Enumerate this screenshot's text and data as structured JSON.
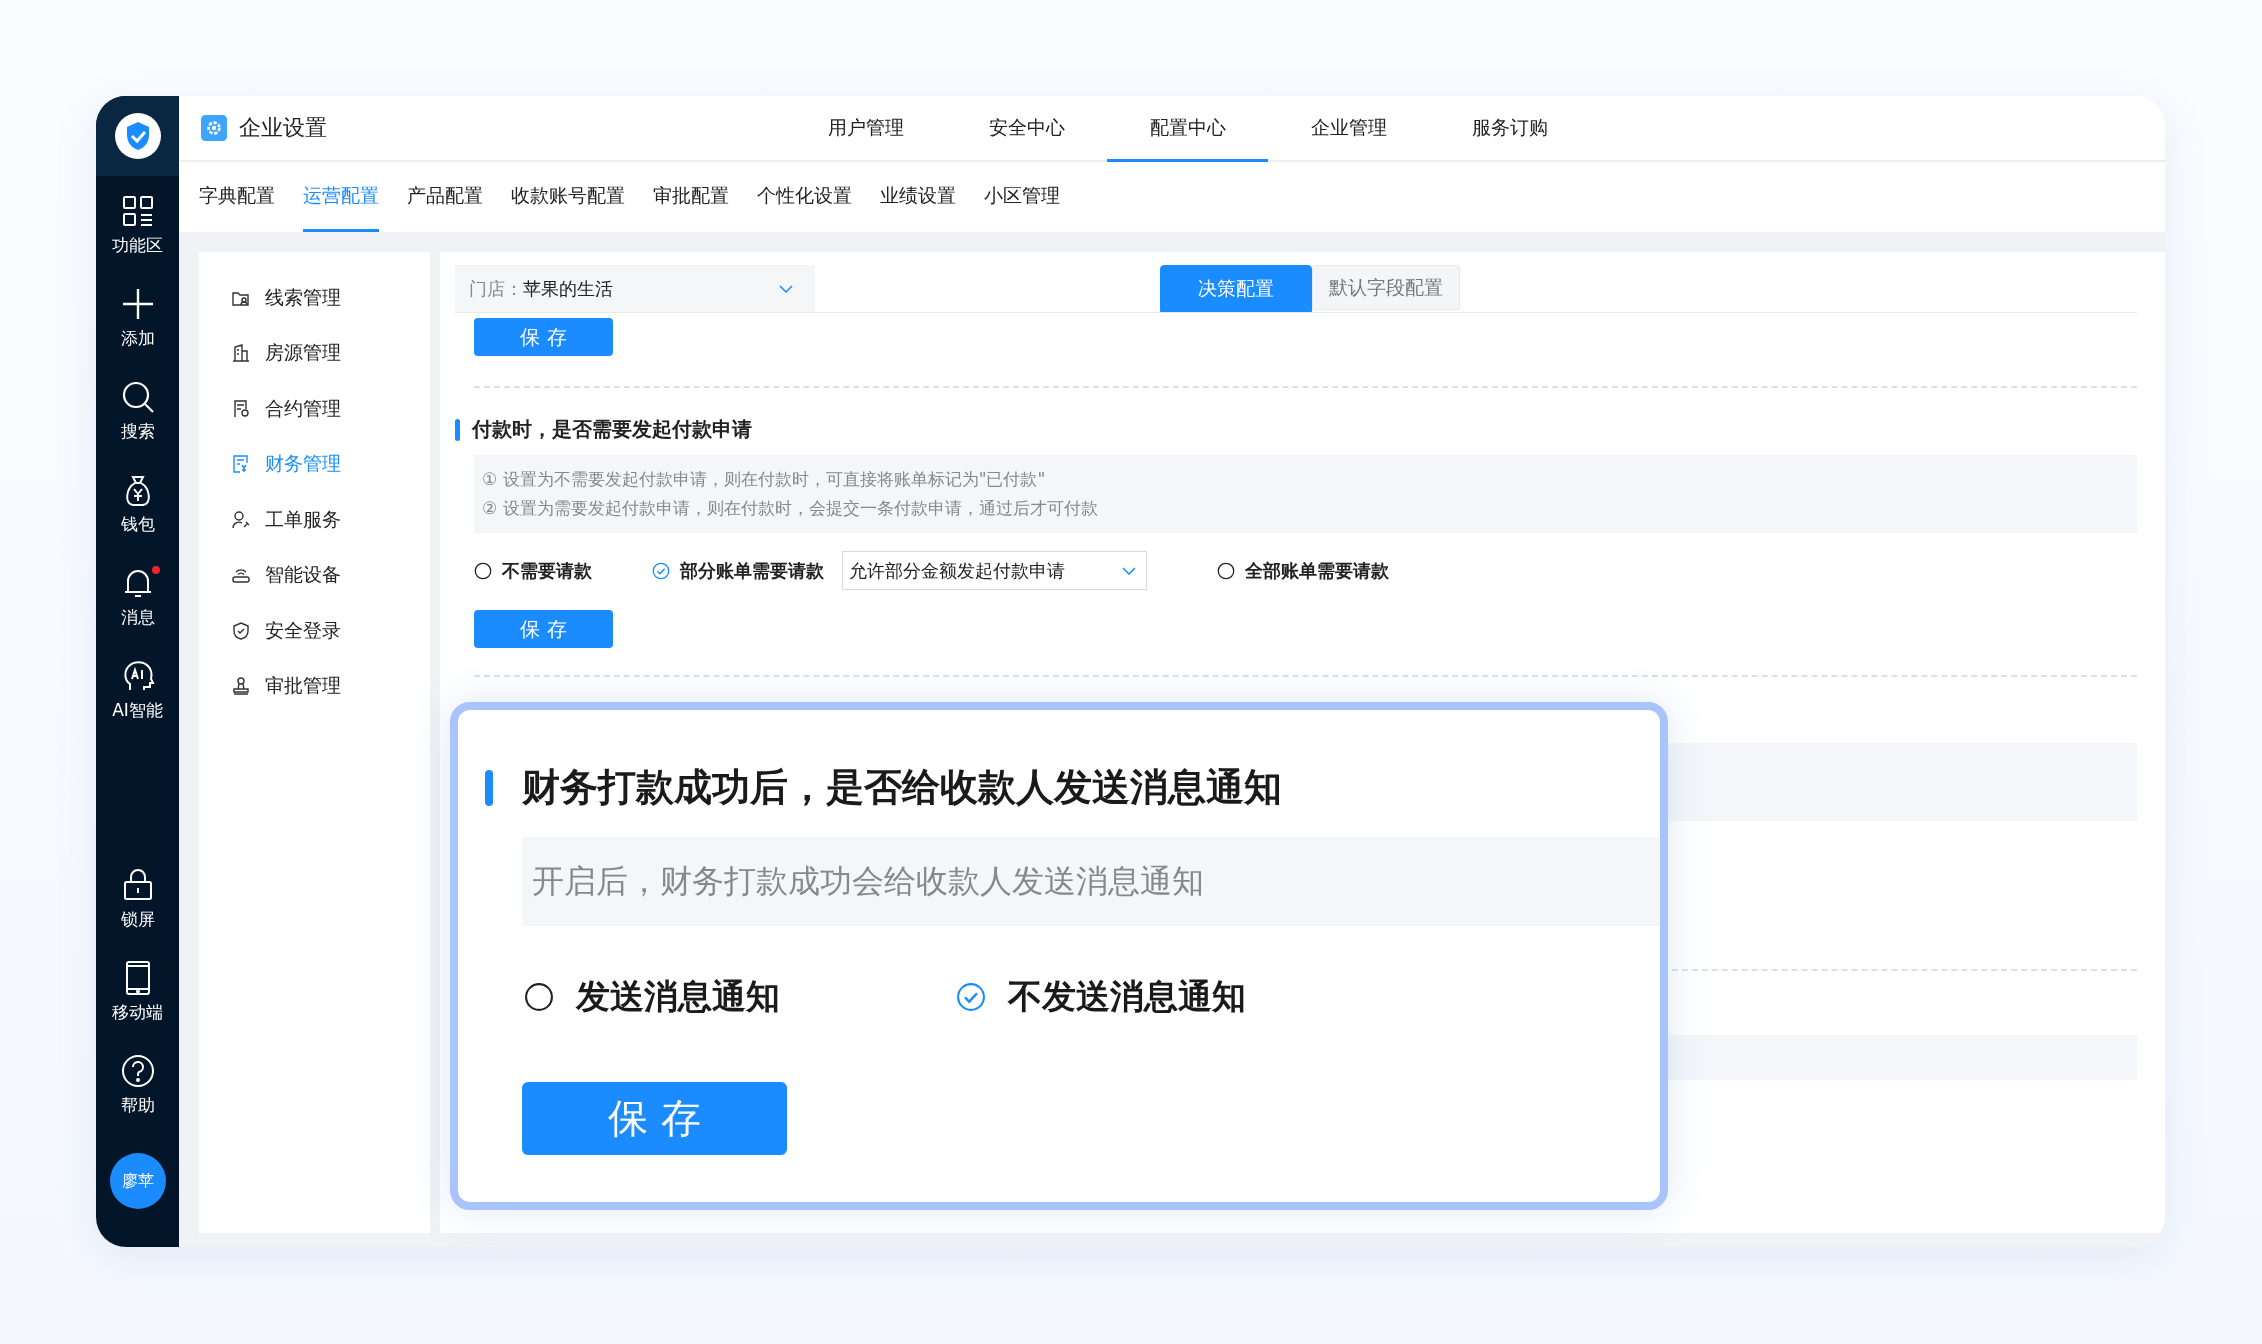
{
  "app": {
    "title": "企业设置"
  },
  "rail": {
    "top": [
      {
        "label": "功能区",
        "kind": "grid",
        "badge": false
      },
      {
        "label": "添加",
        "kind": "plus",
        "badge": false
      },
      {
        "label": "搜索",
        "kind": "search",
        "badge": false
      },
      {
        "label": "钱包",
        "kind": "wallet",
        "badge": false
      },
      {
        "label": "消息",
        "kind": "bell",
        "badge": true
      },
      {
        "label": "AI智能",
        "kind": "ai",
        "badge": false
      }
    ],
    "bottom": [
      {
        "label": "锁屏",
        "kind": "lock",
        "badge": false
      },
      {
        "label": "移动端",
        "kind": "phone",
        "badge": false
      },
      {
        "label": "帮助",
        "kind": "help",
        "badge": false
      }
    ],
    "avatar": "廖苹"
  },
  "top_tabs": [
    {
      "label": "用户管理",
      "selected": false
    },
    {
      "label": "安全中心",
      "selected": false
    },
    {
      "label": "配置中心",
      "selected": true
    },
    {
      "label": "企业管理",
      "selected": false
    },
    {
      "label": "服务订购",
      "selected": false
    }
  ],
  "sub_tabs": [
    {
      "label": "字典配置",
      "selected": false
    },
    {
      "label": "运营配置",
      "selected": true
    },
    {
      "label": "产品配置",
      "selected": false
    },
    {
      "label": "收款账号配置",
      "selected": false
    },
    {
      "label": "审批配置",
      "selected": false
    },
    {
      "label": "个性化设置",
      "selected": false
    },
    {
      "label": "业绩设置",
      "selected": false
    },
    {
      "label": "小区管理",
      "selected": false
    }
  ],
  "menu": [
    {
      "label": "线索管理",
      "kind": "clue",
      "selected": false
    },
    {
      "label": "房源管理",
      "kind": "building",
      "selected": false
    },
    {
      "label": "合约管理",
      "kind": "contract",
      "selected": false
    },
    {
      "label": "财务管理",
      "kind": "finance",
      "selected": true
    },
    {
      "label": "工单服务",
      "kind": "service",
      "selected": false
    },
    {
      "label": "智能设备",
      "kind": "device",
      "selected": false
    },
    {
      "label": "安全登录",
      "kind": "shield",
      "selected": false
    },
    {
      "label": "审批管理",
      "kind": "stamp",
      "selected": false
    }
  ],
  "store": {
    "label": "门店：",
    "value": "苹果的生活"
  },
  "config_tabs": [
    {
      "label": "决策配置",
      "selected": true
    },
    {
      "label": "默认字段配置",
      "selected": false
    }
  ],
  "save_button": "保 存",
  "section": {
    "title": "付款时，是否需要发起付款申请",
    "notes": [
      "① 设置为不需要发起付款申请，则在付款时，可直接将账单标记为\"已付款\"",
      "② 设置为需要发起付款申请，则在付款时，会提交一条付款申请，通过后才可付款"
    ],
    "options": [
      {
        "label": "不需要请款",
        "selected": false
      },
      {
        "label": "部分账单需要请款",
        "selected": true,
        "dropdown": "允许部分金额发起付款申请"
      },
      {
        "label": "全部账单需要请款",
        "selected": false
      }
    ],
    "save": "保 存"
  },
  "callout": {
    "title": "财务打款成功后，是否给收款人发送消息通知",
    "note": "开启后，财务打款成功会给收款人发送消息通知",
    "options": [
      {
        "label": "发送消息通知",
        "selected": false
      },
      {
        "label": "不发送消息通知",
        "selected": true
      }
    ],
    "save": "保 存"
  }
}
